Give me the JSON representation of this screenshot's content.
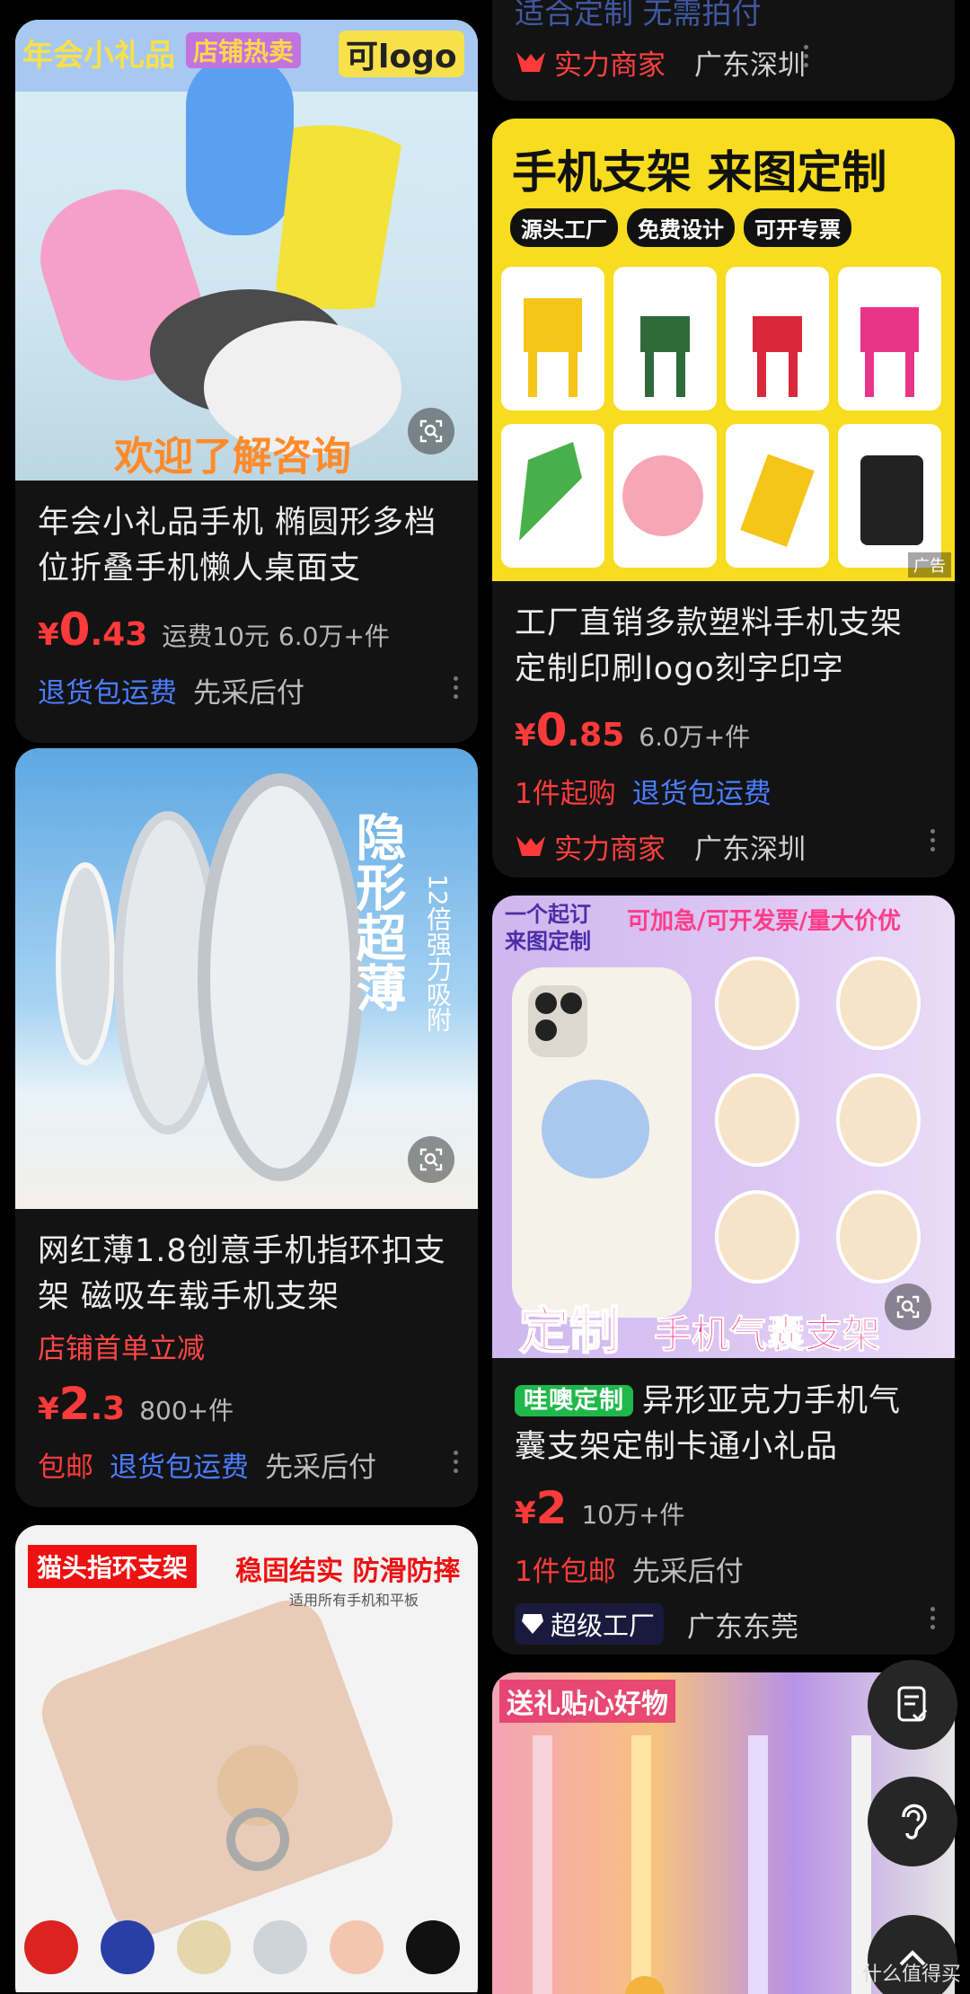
{
  "left": [
    {
      "badges": [
        "年会小礼品",
        "店铺热卖",
        "可logo"
      ],
      "banner": "欢迎了解咨询",
      "title": "年会小礼品手机 椭圆形多档位折叠手机懒人桌面支",
      "price_yen": "¥",
      "price_int": "0",
      "price_dec": ".43",
      "shipping": "运费10元",
      "sold": "6.0万+件",
      "tags": [
        "退货包运费",
        "先采后付"
      ]
    },
    {
      "img_big": "隐形超薄",
      "img_small": "12倍强力吸附",
      "title": "网红薄1.8创意手机指环扣支架  磁吸车载手机支架",
      "promo": "店铺首单立减",
      "price_yen": "¥",
      "price_int": "2",
      "price_dec": ".3",
      "sold": "800+件",
      "tags": [
        "包邮",
        "退货包运费",
        "先采后付"
      ]
    },
    {
      "badge1": "猫头指环支架",
      "badge2": "稳固结实 防滑防摔",
      "badge3": "适用所有手机和平板"
    }
  ],
  "right": [
    {
      "partial_title": "适合定制 无需拍付",
      "shop_label": "实力商家",
      "shop_loc": "广东深圳"
    },
    {
      "img_title": "手机支架 来图定制",
      "checks": [
        "源头工厂",
        "免费设计",
        "可开专票"
      ],
      "ad": "广告",
      "title": "工厂直销多款塑料手机支架定制印刷logo刻字印字",
      "price_yen": "¥",
      "price_int": "0",
      "price_dec": ".85",
      "sold": "6.0万+件",
      "tags": [
        "1件起购",
        "退货包运费"
      ],
      "shop_label": "实力商家",
      "shop_loc": "广东深圳"
    },
    {
      "img_tl": "一个起订\n来图定制",
      "img_tr": "可加急/可开发票/量大价优",
      "img_b1": "定制",
      "img_b2": "手机气囊支架",
      "brand_tag": "哇噢定制",
      "title": "异形亚克力手机气囊支架定制卡通小礼品",
      "price_yen": "¥",
      "price_int": "2",
      "price_dec": "",
      "sold": "10万+件",
      "tags": [
        "1件包邮",
        "先采后付"
      ],
      "shop_label": "超级工厂",
      "shop_loc": "广东东莞"
    },
    {
      "img_title": "送礼贴心好物"
    }
  ],
  "watermark": "什么值得买",
  "colors": {
    "price": "#ff3a3a",
    "blue_tag": "#4a7dff",
    "bg": "#000000",
    "card": "#131313"
  }
}
